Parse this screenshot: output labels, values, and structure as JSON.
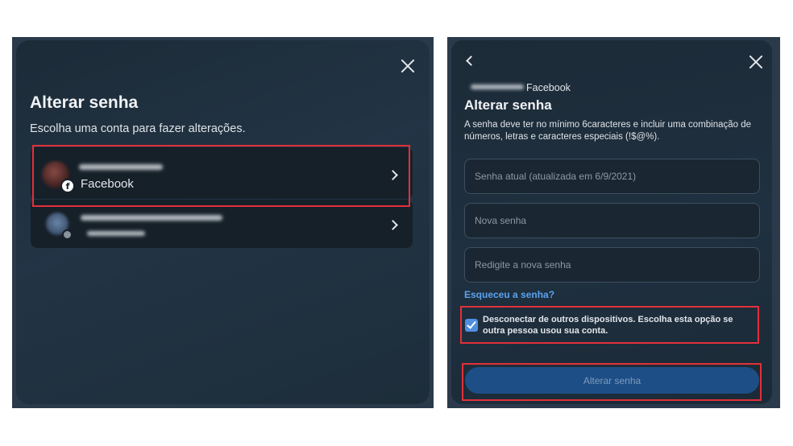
{
  "left_panel": {
    "title": "Alterar senha",
    "subtitle": "Escolha uma conta para fazer alterações.",
    "accounts": [
      {
        "label": "Facebook",
        "icon": "facebook-icon"
      },
      {
        "label": "",
        "icon": "instagram-icon"
      }
    ]
  },
  "right_panel": {
    "account_label": "Facebook",
    "title": "Alterar senha",
    "description": "A senha deve ter no mínimo 6caracteres e incluir uma combinação de números, letras e caracteres especiais (!$@%).",
    "fields": {
      "current_placeholder": "Senha atual (atualizada em 6/9/2021)",
      "new_placeholder": "Nova senha",
      "retype_placeholder": "Redigite a nova senha"
    },
    "forgot_link": "Esqueceu a senha?",
    "logout_others": {
      "checked": true,
      "label": "Desconectar de outros dispositivos. Escolha esta opção se outra pessoa usou sua conta."
    },
    "submit_label": "Alterar senha"
  },
  "colors": {
    "dialog_bg": "#1f3040",
    "card_bg": "#162029",
    "highlight_red": "#e2303a",
    "link_blue": "#5aa3f0",
    "button_blue": "#1d4e86"
  }
}
